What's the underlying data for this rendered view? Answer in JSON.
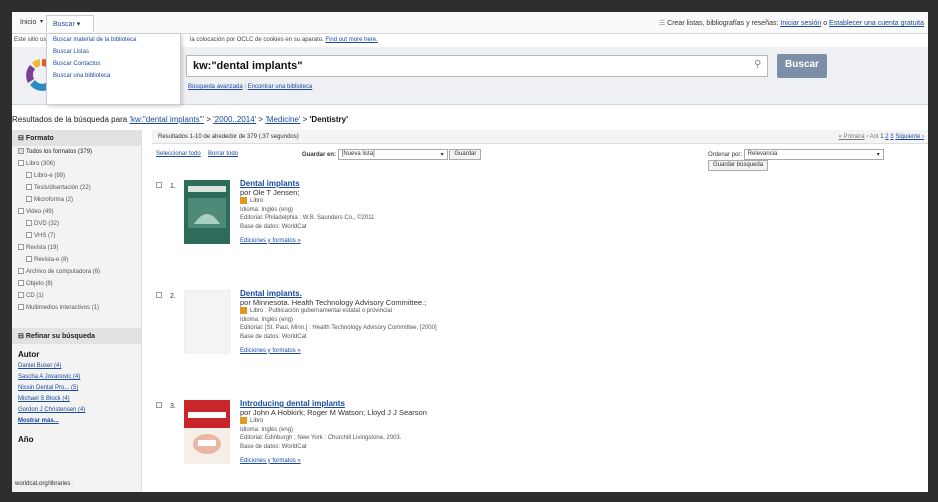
{
  "nav": {
    "inicio": "Inicio",
    "buscar": "Buscar",
    "right_text": "Crear listas, bibliografías y reseñas:",
    "login_link": "Iniciar sesión",
    "or": "o",
    "create_link": "Establecer una cuenta gratuita"
  },
  "dropdown": [
    "Buscar material de la biblioteca",
    "Buscar Listas",
    "Buscar Contactos",
    "Buscar una biblioteca"
  ],
  "cookie": {
    "prefix": "Este sitio usa c",
    "text": "la colocación por OCLC de cookies en su aparato.",
    "link": "Find out more here."
  },
  "search": {
    "query": "kw:\"dental implants\"",
    "button": "Buscar",
    "advanced": "Búsqueda avanzada",
    "find_library": "Encontrar una biblioteca"
  },
  "results_line": {
    "prefix": "Resultados de la búsqueda para",
    "q1": "'kw:\"dental implants\"'",
    "sep": " > ",
    "q2": "'2000..2014'",
    "q3": "'Medicine'",
    "q4": "'Dentistry'"
  },
  "sidebar": {
    "formato_header": "Formato",
    "formats": [
      {
        "label": "Todos los formatos (379)",
        "level": 0
      },
      {
        "label": "Libro (306)",
        "level": 0
      },
      {
        "label": "Libro-e (99)",
        "level": 1
      },
      {
        "label": "Tesis/disertación (22)",
        "level": 1
      },
      {
        "label": "Microforma (2)",
        "level": 1
      },
      {
        "label": "Video (49)",
        "level": 0
      },
      {
        "label": "DVD (32)",
        "level": 1
      },
      {
        "label": "VHS (7)",
        "level": 1
      },
      {
        "label": "Revista (19)",
        "level": 0
      },
      {
        "label": "Revista-e (8)",
        "level": 1
      },
      {
        "label": "Archivo de computadora (6)",
        "level": 0
      },
      {
        "label": "Objeto (8)",
        "level": 0
      },
      {
        "label": "CD (1)",
        "level": 0
      },
      {
        "label": "Multimedios interactivos (1)",
        "level": 0
      }
    ],
    "refine_header": "Refinar su búsqueda",
    "autor_header": "Autor",
    "authors": [
      "Daniel Buser (4)",
      "Sascha A Jovanovic (4)",
      "Nissin Dental Pro... (5)",
      "Michael S Block (4)",
      "Gordon J Christensen (4)"
    ],
    "show_more": "Mostrar más...",
    "ano_header": "Año"
  },
  "main": {
    "results_count": "Resultados 1-10 de alrededor de 379 (.37 segundos)",
    "pagination": [
      "« Primera",
      "‹ Ant",
      "1",
      "2",
      "3",
      "Siguiente ›"
    ],
    "select_all": "Seleccionar todo",
    "clear_all": "Borrar todo",
    "save_in": "Guardar en:",
    "new_list": "[Nueva lista]",
    "save_btn": "Guardar",
    "order_by": "Ordenar por:",
    "order_value": "Relevancia",
    "save_search_btn": "Guardar búsqueda"
  },
  "results": [
    {
      "num": "1.",
      "title": "Dental implants",
      "by": "por Ole T Jensen;",
      "format": "Libro",
      "lang": "Idioma: Inglés (eng)",
      "pub": "Editorial: Philadelphia : W.B. Saunders Co., ©2011",
      "db": "Base de datos: WorldCat",
      "editions": "Ediciones y formatos »"
    },
    {
      "num": "2.",
      "title": "Dental implants.",
      "by": "por Minnesota. Health Technology Advisory Committee.;",
      "format": "Libro : Publicación gubernamental estatal o provincial",
      "lang": "Idioma: Inglés (eng)",
      "pub": "Editorial: [St. Paul, Minn.] : Health Technology Advisory Committee, [2000]",
      "db": "Base de datos: WorldCat",
      "editions": "Ediciones y formatos »"
    },
    {
      "num": "3.",
      "title": "Introducing dental implants",
      "by": "por John A Hobkirk; Roger M Watson; Lloyd J J Searson",
      "format": "Libro",
      "lang": "Idioma: Inglés (eng)",
      "pub": "Editorial: Edinburgh ; New York : Churchill Livingstone, 2003.",
      "db": "Base de datos: WorldCat",
      "editions": "Ediciones y formatos »"
    }
  ],
  "status_url": "worldcat.org/libraries"
}
